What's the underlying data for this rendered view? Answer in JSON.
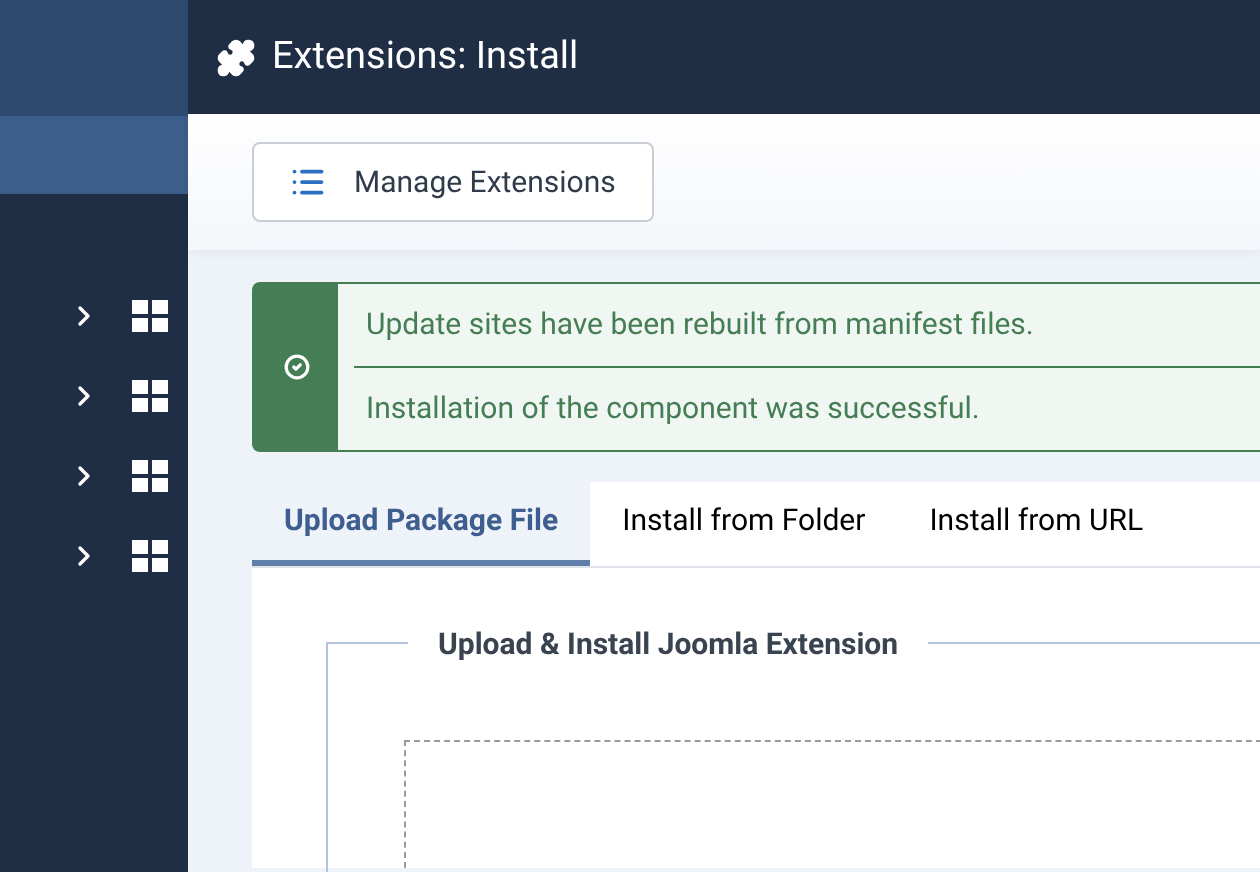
{
  "header": {
    "title": "Extensions: Install"
  },
  "sidebar": {
    "toggle": {
      "selected": true
    },
    "items": [
      {
        "expanded": false
      },
      {
        "expanded": false
      },
      {
        "expanded": false
      },
      {
        "expanded": false
      }
    ]
  },
  "toolbar": {
    "buttons": [
      "Manage Extensions"
    ]
  },
  "alert": {
    "kind": "success",
    "messages": [
      "Update sites have been rebuilt from manifest files.",
      "Installation of the component was successful."
    ]
  },
  "tabs": [
    {
      "label": "Upload Package File",
      "selected": true
    },
    {
      "label": "Install from Folder",
      "selected": false
    },
    {
      "label": "Install from URL",
      "selected": false
    }
  ],
  "fieldset": {
    "legend": "Upload & Install Joomla Extension"
  }
}
